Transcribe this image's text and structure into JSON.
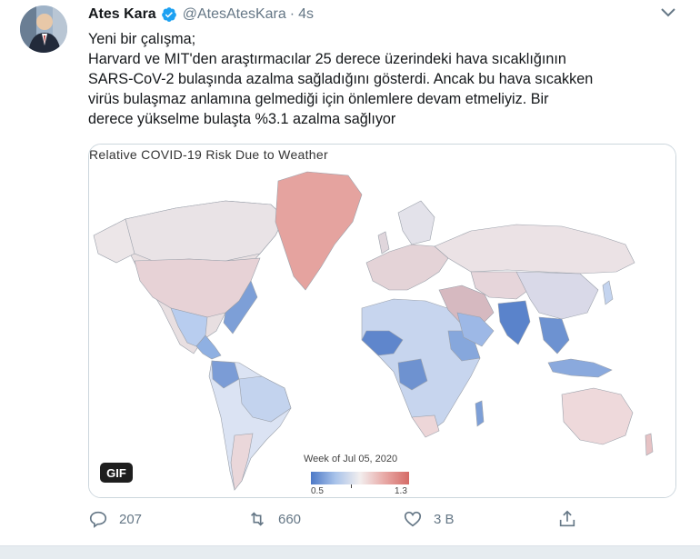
{
  "tweet": {
    "name": "Ates Kara",
    "handle": "@AtesAtesKara",
    "separator": "·",
    "time": "4s",
    "text_lines": [
      "Yeni bir çalışma;",
      "Harvard ve MIT'den araştırmacılar 25 derece üzerindeki hava sıcaklığının",
      "SARS-CoV-2 bulaşında azalma sağladığını gösterdi. Ancak bu hava sıcakken",
      "virüs bulaşmaz anlamına gelmediği için önlemlere devam etmeliyiz. Bir",
      "derece yükselme bulaşta %3.1 azalma sağlıyor"
    ]
  },
  "media": {
    "map_title": "Relative COVID-19 Risk Due to Weather",
    "badge": "GIF",
    "legend": {
      "title": "Week of Jul 05, 2020",
      "min": "0.5",
      "max": "1.3",
      "colors": [
        "#4d79c7",
        "#a9c3ea",
        "#f2eeee",
        "#e8a9a6",
        "#d56b66"
      ]
    }
  },
  "actions": {
    "reply_count": "207",
    "retweet_count": "660",
    "like_count": "3 B"
  },
  "icons": [
    "verified-icon",
    "chevron-down-icon",
    "reply-icon",
    "retweet-icon",
    "like-icon",
    "share-icon"
  ]
}
